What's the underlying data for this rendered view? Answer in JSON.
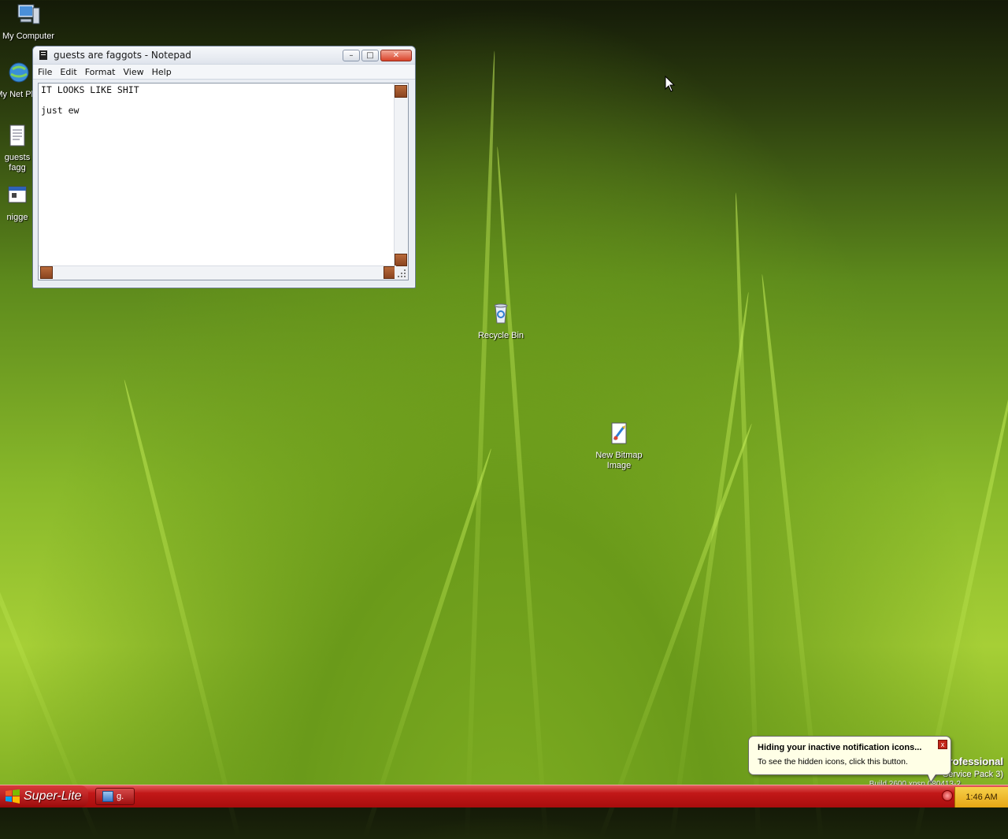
{
  "desktop": {
    "icons": [
      {
        "label": "My Computer",
        "icon": "my-computer-icon"
      },
      {
        "label": "My Net Plac",
        "icon": "network-places-icon"
      },
      {
        "label": "guests fagg",
        "icon": "text-file-icon"
      },
      {
        "label": "nigge",
        "icon": "executable-file-icon"
      },
      {
        "label": "Recycle Bin",
        "icon": "recycle-bin-icon"
      },
      {
        "label": "New Bitmap Image",
        "icon": "bitmap-file-icon"
      }
    ]
  },
  "notepad": {
    "title": "guests are faggots - Notepad",
    "menu": [
      "File",
      "Edit",
      "Format",
      "View",
      "Help"
    ],
    "content_line1": "IT LOOKS LIKE SHIT",
    "content_line2": "just ew",
    "buttons": {
      "minimize": "–",
      "maximize": "□",
      "close": "✕"
    }
  },
  "balloon": {
    "title": "Hiding your inactive notification icons...",
    "text": "To see the hidden icons, click this button.",
    "close": "x"
  },
  "watermark": {
    "line1": "rofessional",
    "line2": "Service Pack 3)",
    "line3": "Build 2600.xpsp.080413-2"
  },
  "taskbar": {
    "start_label": "Super-Lite",
    "task_label": "g.",
    "clock": "1:46 AM"
  },
  "colors": {
    "taskbar": "#b81414",
    "tray": "#f0c030",
    "balloon_bg": "#ffffe6"
  }
}
